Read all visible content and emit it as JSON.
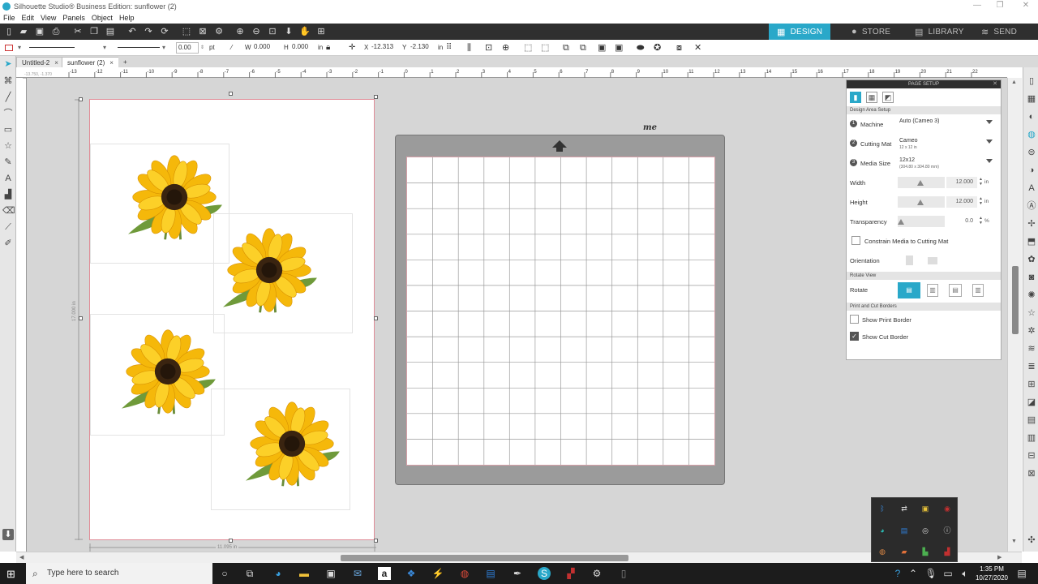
{
  "window": {
    "title": "Silhouette Studio® Business Edition: sunflower (2)"
  },
  "menu": [
    "File",
    "Edit",
    "View",
    "Panels",
    "Object",
    "Help"
  ],
  "mode_tabs": [
    {
      "label": "DESIGN",
      "icon": "design-icon",
      "active": true
    },
    {
      "label": "STORE",
      "icon": "store-icon",
      "active": false
    },
    {
      "label": "LIBRARY",
      "icon": "library-icon",
      "active": false
    },
    {
      "label": "SEND",
      "icon": "send-icon",
      "active": false
    }
  ],
  "toolbar2": {
    "line_width": "0.00",
    "line_unit": "pt",
    "w_label": "W",
    "w_value": "0.000",
    "h_label": "H",
    "h_value": "0.000",
    "dim_unit": "in",
    "x_label": "X",
    "x_value": "-12.313",
    "y_label": "Y",
    "y_value": "-2.130",
    "pos_unit": "in"
  },
  "doc_tabs": [
    "Untitled-2",
    "sunflower (2)"
  ],
  "rulers": {
    "h_labels": [
      "-13",
      "-12",
      "-11",
      "-10",
      "-9",
      "-8",
      "-7",
      "-6",
      "-5",
      "-4",
      "-3",
      "-2",
      "-1",
      "0",
      "1",
      "2",
      "3",
      "4",
      "5",
      "6",
      "7",
      "8",
      "9",
      "10",
      "11",
      "12",
      "13",
      "14",
      "15",
      "16",
      "17",
      "18",
      "19",
      "20",
      "21",
      "22"
    ],
    "cursor_readout": "-13.750, -1.370"
  },
  "page": {
    "height_label": "17.000 in",
    "width_label": "11.095 in"
  },
  "mat": {
    "brand_logo": "me"
  },
  "page_setup": {
    "title": "PAGE SETUP",
    "section_design": "Design Area Setup",
    "machine": {
      "num": "1",
      "label": "Machine",
      "value": "Auto (Cameo 3)"
    },
    "cutting_mat": {
      "num": "2",
      "label": "Cutting Mat",
      "value": "Cameo",
      "sub": "12 x 12 in"
    },
    "media_size": {
      "num": "3",
      "label": "Media Size",
      "value": "12x12",
      "sub": "(304.80 x 304.80 mm)"
    },
    "width": {
      "label": "Width",
      "value": "12.000",
      "unit": "in"
    },
    "height": {
      "label": "Height",
      "value": "12.000",
      "unit": "in"
    },
    "transparency": {
      "label": "Transparency",
      "value": "0.0",
      "unit": "%"
    },
    "constrain": {
      "label": "Constrain Media to Cutting Mat",
      "checked": false
    },
    "orientation": {
      "label": "Orientation"
    },
    "section_rotate": "Rotate View",
    "rotate": {
      "label": "Rotate"
    },
    "section_borders": "Print and Cut Borders",
    "show_print_border": {
      "label": "Show Print Border",
      "checked": false
    },
    "show_cut_border": {
      "label": "Show Cut Border",
      "checked": true
    }
  },
  "taskbar": {
    "search_placeholder": "Type here to search",
    "time": "1:35 PM",
    "date": "10/27/2020"
  },
  "colors": {
    "accent": "#29a8c9",
    "toolbar": "#2f2f2f",
    "canvas": "#d6d6d6",
    "mat": "#9b9b9b",
    "cut_border": "#e08c97"
  }
}
